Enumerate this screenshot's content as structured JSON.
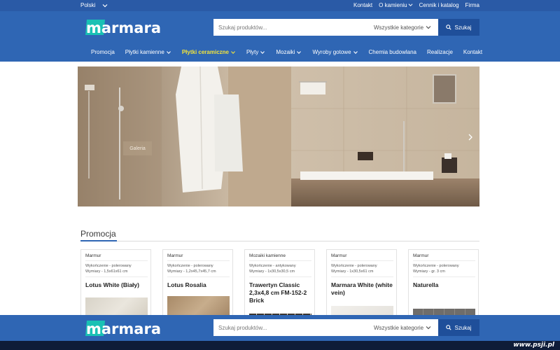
{
  "topbar": {
    "language": "Polski",
    "links": [
      "Kontakt",
      "O kamieniu",
      "Cennik i katalog",
      "Firma"
    ]
  },
  "header": {
    "logo_text": "marmara",
    "search": {
      "placeholder": "Szukaj produktów...",
      "category": "Wszystkie kategorie",
      "button": "Szukaj"
    },
    "nav": [
      {
        "label": "Promocja",
        "dropdown": false,
        "active": false
      },
      {
        "label": "Płytki kamienne",
        "dropdown": true,
        "active": false
      },
      {
        "label": "Płytki ceramiczne",
        "dropdown": true,
        "active": true
      },
      {
        "label": "Płyty",
        "dropdown": true,
        "active": false
      },
      {
        "label": "Mozaiki",
        "dropdown": true,
        "active": false
      },
      {
        "label": "Wyroby gotowe",
        "dropdown": true,
        "active": false
      },
      {
        "label": "Chemia budowlana",
        "dropdown": false,
        "active": false
      },
      {
        "label": "Realizacje",
        "dropdown": false,
        "active": false
      },
      {
        "label": "Kontakt",
        "dropdown": false,
        "active": false
      }
    ]
  },
  "hero": {
    "button": "Galeria"
  },
  "promo": {
    "title": "Promocja",
    "cards": [
      {
        "category": "Marmur",
        "finish": "Wykończenie - polerowany",
        "dims": "Wymiary - 1,5x61x61 cm",
        "name": "Lotus White (Biały)"
      },
      {
        "category": "Marmur",
        "finish": "Wykończenie - polerowany",
        "dims": "Wymiary - 1,2x45,7x45,7 cm",
        "name": "Lotus Rosalia"
      },
      {
        "category": "Mozaiki kamienne",
        "finish": "Wykończenie - antykowany",
        "dims": "Wymiary - 1x30,5x30,5 cm",
        "name": "Trawertyn Classic 2,3x4,8 cm FM-152-2 Brick"
      },
      {
        "category": "Marmur",
        "finish": "Wykończenie - polerowany",
        "dims": "Wymiary - 1x30,5x61 cm",
        "name": "Marmara White (white vein)"
      },
      {
        "category": "Marmur",
        "finish": "Wykończenie - polerowany",
        "dims": "Wymiary - gr. 3 cm",
        "name": "Naturella"
      }
    ]
  },
  "sticky": {
    "logo_text": "marmara",
    "search": {
      "placeholder": "Szukaj produktów...",
      "category": "Wszystkie kategorie",
      "button": "Szukaj"
    }
  },
  "watermark": "www.psji.pl",
  "colors": {
    "topbar": "#2a5aa6",
    "header": "#2f66b4",
    "search_button": "#1f4f9a",
    "nav_active": "#f3e43a",
    "logo_teal": "#19c1b4"
  }
}
